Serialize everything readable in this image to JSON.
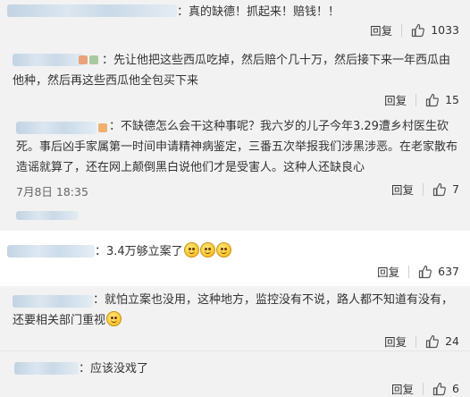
{
  "comments": [
    {
      "text": "：真的缺德！抓起来！赔钱！！",
      "reply": "回复",
      "likes": "1033"
    },
    {
      "text": "：先让他把这些西瓜吃掉，然后赔个几十万，然后接下来一年西瓜由他种，然后再这些西瓜他全包买下来",
      "reply": "回复",
      "likes": "15"
    },
    {
      "text": "：不缺德怎么会干这种事呢？我六岁的儿子今年3.29遭乡村医生砍死。事后凶手家属第一时间申请精神病鉴定，三番五次举报我们涉黑涉恶。在老家散布造谣就算了，还在网上颠倒黑白说他们才是受害人。这种人还缺良心",
      "timestamp": "7月8日 18:35",
      "reply": "回复",
      "likes": "7"
    },
    {
      "text": "：3.4万够立案了",
      "emoji_count": 3,
      "emoji_name": "smile-emoji",
      "reply": "回复",
      "likes": "637"
    },
    {
      "text": "：就怕立案也没用，这种地方，监控没有不说，路人都不知道有没有，还要相关部门重视",
      "emoji_name": "sweat-emoji",
      "reply": "回复",
      "likes": "24"
    },
    {
      "text": "：应该没戏了",
      "reply": "回复",
      "likes": "6"
    }
  ],
  "colors": {
    "name_blur": "#c3d5e6",
    "subpanel_bg": "#f2f2f2",
    "text": "#333333",
    "icon": "#555555"
  },
  "icons": {
    "like": "thumbs-up-icon"
  }
}
